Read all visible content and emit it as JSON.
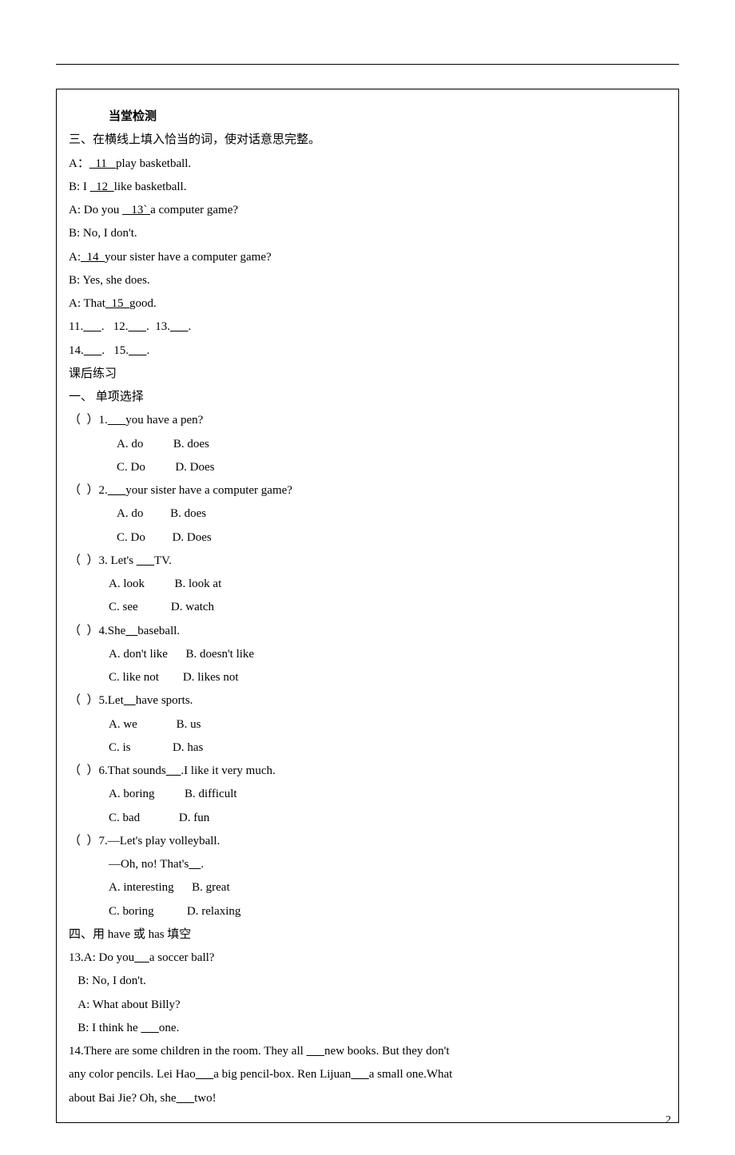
{
  "pageNumber": "2",
  "heading1": "当堂检测",
  "section3": {
    "title": "三、在横线上填入恰当的词，使对话意思完整。",
    "l1": "A：",
    "l1b": "  11   ",
    "l1c": "play basketball.",
    "l2": "B: I ",
    "l2b": "  12  ",
    "l2c": "like basketball.",
    "l3": "A: Do you ",
    "l3b": "   13` ",
    "l3c": "a computer game?",
    "l4": "B: No, I don't.",
    "l5": "A:",
    "l5b": "  14  ",
    "l5c": "your sister have a computer game?",
    "l6": "B: Yes, she does.",
    "l7": "A: That",
    "l7b": "  15  ",
    "l7c": "good.",
    "ans1": "11.",
    "ans1b": "      ",
    "ans1c": ".   12.",
    "ans1d": "      ",
    "ans1e": ".  13.",
    "ans1f": "      ",
    "ans1g": ".",
    "ans2": "14.",
    "ans2b": "      ",
    "ans2c": ".   15.",
    "ans2d": "      ",
    "ans2e": "."
  },
  "afterClass": "课后练习",
  "section1": {
    "title": "一、 单项选择",
    "q1": "（  ）1.",
    "q1b": "      ",
    "q1c": "you have a pen?",
    "q1optA": "A. do          B. does",
    "q1optC": "C. Do          D. Does",
    "q2": "（  ）2.",
    "q2b": "      ",
    "q2c": "your sister have a computer game?",
    "q2optA": "A. do         B. does",
    "q2optC": "C. Do         D. Does",
    "q3": "（  ）3. Let's ",
    "q3b": "      ",
    "q3c": "TV.",
    "q3optA": "A. look          B. look at",
    "q3optC": "C. see           D. watch",
    "q4": "（  ）4.She",
    "q4b": "    ",
    "q4c": "baseball.",
    "q4optA": "A. don't like      B. doesn't like",
    "q4optC": "C. like not        D. likes not",
    "q5": "（  ）5.Let",
    "q5b": "    ",
    "q5c": "have sports.",
    "q5optA": "A. we             B. us",
    "q5optC": "C. is              D. has",
    "q6": "（  ）6.That sounds",
    "q6b": "     ",
    "q6c": ".I like it very much.",
    "q6optA": "A. boring          B. difficult",
    "q6optC": "C. bad             D. fun",
    "q7": "（  ）7.—Let's play volleyball.",
    "q7line2": "—Oh, no! That's",
    "q7b": "    ",
    "q7c": ".",
    "q7optA": "A. interesting      B. great",
    "q7optC": "C. boring           D. relaxing"
  },
  "section4": {
    "title": "四、用 have 或 has 填空",
    "q13a": "13.A: Do you",
    "q13ab": "     ",
    "q13ac": "a soccer ball?",
    "q13b": "   B: No, I don't.",
    "q13c": "   A: What about Billy?",
    "q13d": "   B: I think he ",
    "q13db": "      ",
    "q13dc": "one.",
    "q14a": "14.There are some children in the room. They all ",
    "q14ab": "      ",
    "q14ac": "new books. But they don't",
    "q14b": "any color pencils. Lei Hao",
    "q14bb": "      ",
    "q14bc": "a big pencil-box. Ren Lijuan",
    "q14bd": "      ",
    "q14be": "a small one.What",
    "q14c": "about Bai Jie? Oh, she",
    "q14cb": "      ",
    "q14cc": "two!"
  }
}
